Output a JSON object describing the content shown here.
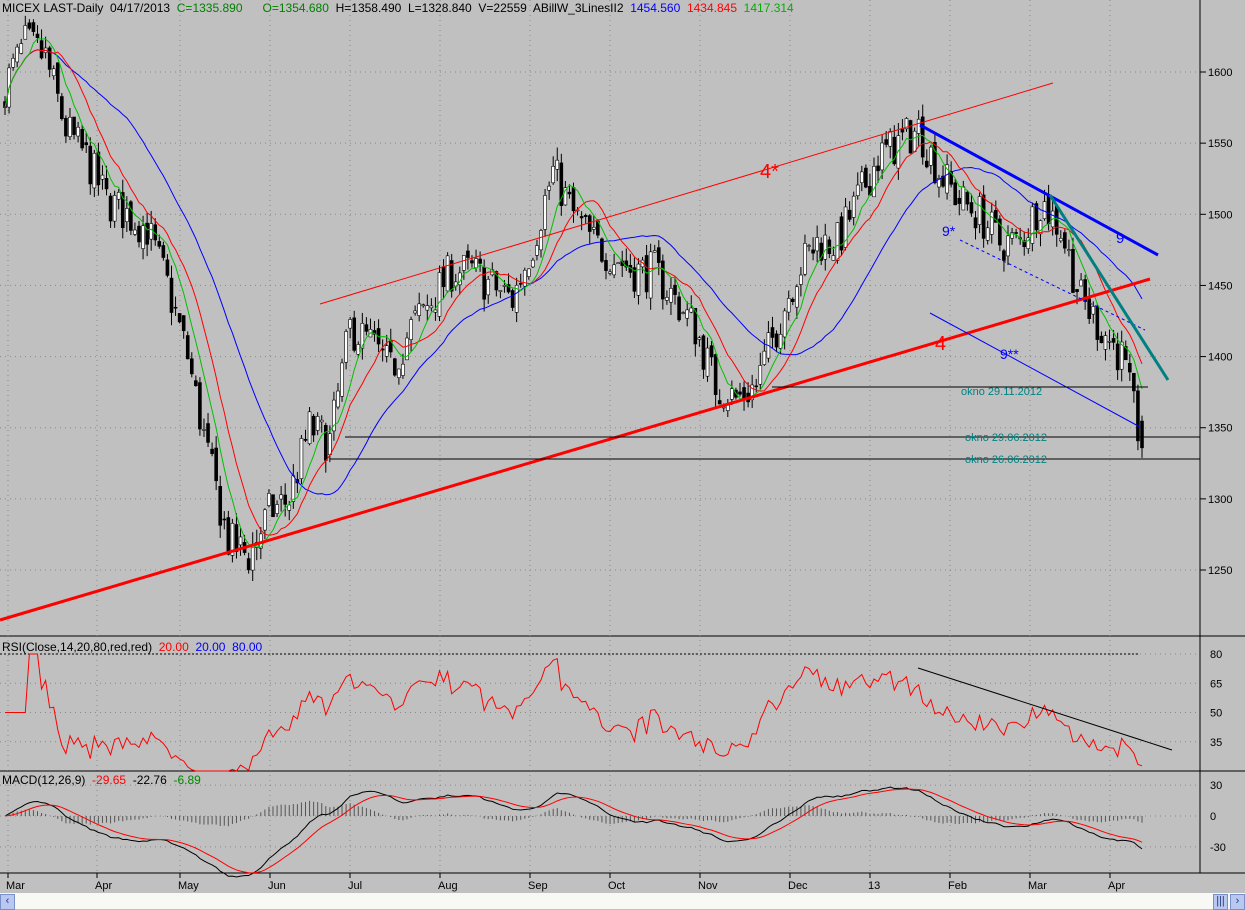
{
  "header": {
    "symbol": "MICEX LAST-Daily",
    "date": "04/17/2013",
    "close": "C=1335.890",
    "open": "O=1354.680",
    "high": "H=1358.490",
    "low": "L=1328.840",
    "volume": "V=22559",
    "indicator": "ABillW_3LinesII2",
    "ma_blue": "1454.560",
    "ma_red": "1434.845",
    "ma_green": "1417.314"
  },
  "rsi_header": {
    "label": "RSI(Close,14,20,80,red,red)",
    "v1": "20.00",
    "v2": "20.00",
    "v3": "80.00"
  },
  "macd_header": {
    "label": "MACD(12,26,9)",
    "v1": "-29.65",
    "v2": "-22.76",
    "v3": "-6.89"
  },
  "annotations": {
    "wave_4star": "4*",
    "wave_4": "4",
    "wave_9": "9",
    "wave_9star": "9*",
    "wave_9dstar": "9**",
    "okno1": "okno 29.11.2012",
    "okno2": "okno 29.06.2012",
    "okno3": "okno 26.06.2012"
  },
  "colors": {
    "bg": "#c0c0c0",
    "up": "#000000",
    "ma_blue": "#0000ff",
    "ma_red": "#ff0000",
    "ma_green": "#00c000",
    "teal": "#008080"
  },
  "chart_data": {
    "type": "candlestick",
    "title": "MICEX LAST-Daily",
    "price_ticks": [
      "1600",
      "1550",
      "1500",
      "1450",
      "1400",
      "1350",
      "1300",
      "1250"
    ],
    "ylim": [
      1205,
      1650
    ],
    "rsi_ticks": [
      "80",
      "65",
      "50",
      "35"
    ],
    "macd_ticks": [
      "30",
      "0",
      "-30"
    ],
    "x_ticks": [
      "Mar",
      "Apr",
      "May",
      "Jun",
      "Jul",
      "Aug",
      "Sep",
      "Oct",
      "Nov",
      "Dec",
      "13",
      "Feb",
      "Mar",
      "Apr"
    ],
    "weekly_closes_approx": [
      1590,
      1620,
      1610,
      1560,
      1540,
      1510,
      1500,
      1490,
      1450,
      1400,
      1330,
      1270,
      1260,
      1290,
      1300,
      1350,
      1340,
      1420,
      1410,
      1390,
      1420,
      1440,
      1460,
      1460,
      1450,
      1440,
      1480,
      1530,
      1500,
      1480,
      1470,
      1460,
      1460,
      1440,
      1420,
      1380,
      1370,
      1380,
      1420,
      1460,
      1480,
      1480,
      1510,
      1540,
      1550,
      1560,
      1530,
      1510,
      1500,
      1480,
      1480,
      1510,
      1490,
      1440,
      1420,
      1400,
      1336
    ]
  }
}
